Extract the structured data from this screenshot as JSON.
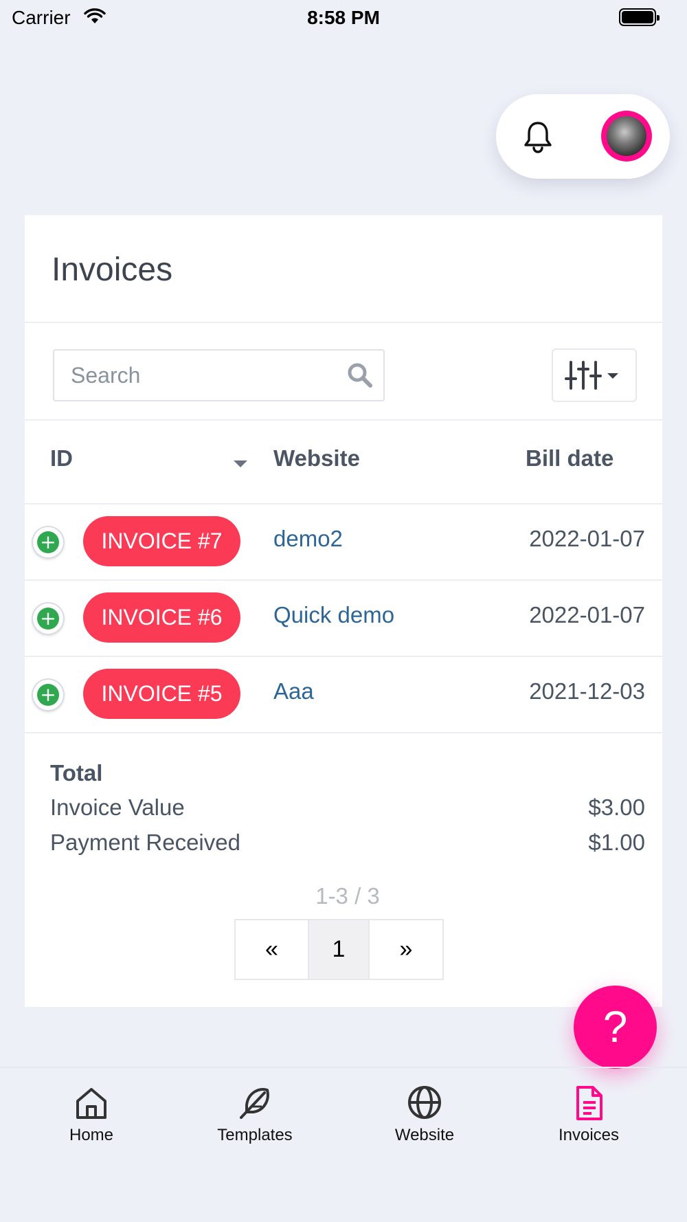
{
  "status_bar": {
    "carrier": "Carrier",
    "time": "8:58 PM"
  },
  "header": {
    "notification_icon": "bell-icon",
    "avatar_ring_color": "#ff0a8a"
  },
  "page": {
    "title": "Invoices"
  },
  "search": {
    "placeholder": "Search",
    "value": ""
  },
  "table": {
    "headers": {
      "id": "ID",
      "website": "Website",
      "bill_date": "Bill date"
    },
    "rows": [
      {
        "invoice": "INVOICE #7",
        "website": "demo2",
        "bill_date": "2022-01-07"
      },
      {
        "invoice": "INVOICE #6",
        "website": "Quick demo",
        "bill_date": "2022-01-07"
      },
      {
        "invoice": "INVOICE #5",
        "website": "Aaa",
        "bill_date": "2021-12-03"
      }
    ]
  },
  "totals": {
    "label": "Total",
    "invoice_value_label": "Invoice Value",
    "invoice_value": "$3.00",
    "payment_received_label": "Payment Received",
    "payment_received": "$1.00"
  },
  "pagination": {
    "range": "1-3 / 3",
    "prev": "«",
    "current": "1",
    "next": "»"
  },
  "help": {
    "label": "?"
  },
  "nav": {
    "items": [
      {
        "label": "Home",
        "icon": "home-icon"
      },
      {
        "label": "Templates",
        "icon": "feather-icon"
      },
      {
        "label": "Website",
        "icon": "globe-icon"
      },
      {
        "label": "Invoices",
        "icon": "document-icon"
      }
    ],
    "active": "Invoices"
  },
  "colors": {
    "accent": "#ff0a8a",
    "invoice_badge": "#fb3a55",
    "link": "#2d6696",
    "expand_green": "#2fa84f",
    "background": "#eef0f8"
  }
}
